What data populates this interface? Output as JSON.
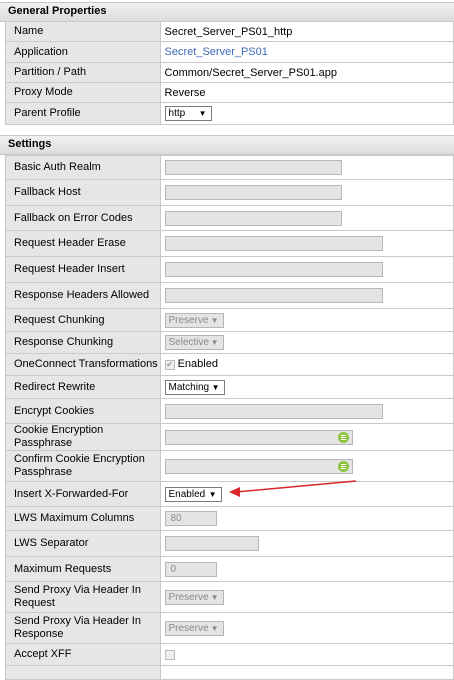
{
  "general": {
    "title": "General Properties",
    "rows": [
      {
        "label": "Name",
        "value": "Secret_Server_PS01_http"
      },
      {
        "label": "Application",
        "value": "Secret_Server_PS01"
      },
      {
        "label": "Partition / Path",
        "value": "Common/Secret_Server_PS01.app"
      },
      {
        "label": "Proxy Mode",
        "value": "Reverse"
      },
      {
        "label": "Parent Profile",
        "value": "http"
      }
    ]
  },
  "settings": {
    "title": "Settings",
    "rows": [
      {
        "label": "Basic Auth Realm"
      },
      {
        "label": "Fallback Host"
      },
      {
        "label": "Fallback on Error Codes"
      },
      {
        "label": "Request Header Erase"
      },
      {
        "label": "Request Header Insert"
      },
      {
        "label": "Response Headers Allowed"
      },
      {
        "label": "Request Chunking",
        "value": "Preserve"
      },
      {
        "label": "Response Chunking",
        "value": "Selective"
      },
      {
        "label": "OneConnect Transformations",
        "value": "Enabled"
      },
      {
        "label": "Redirect Rewrite",
        "value": "Matching"
      },
      {
        "label": "Encrypt Cookies"
      },
      {
        "label": "Cookie Encryption Passphrase"
      },
      {
        "label": "Confirm Cookie Encryption Passphrase"
      },
      {
        "label": "Insert X-Forwarded-For",
        "value": "Enabled"
      },
      {
        "label": "LWS Maximum Columns",
        "value": "80"
      },
      {
        "label": "LWS Separator"
      },
      {
        "label": "Maximum Requests",
        "value": "0"
      },
      {
        "label": "Send Proxy Via Header In Request",
        "value": "Preserve"
      },
      {
        "label": "Send Proxy Via Header In Response",
        "value": "Preserve"
      },
      {
        "label": "Accept XFF"
      }
    ]
  },
  "icons": {
    "dropdown": "chevron-down-icon",
    "passphrase": "password-generator-icon",
    "annotation": "red-arrow"
  },
  "colors": {
    "link": "#3c68b6",
    "annotation_arrow": "#d9262a",
    "icon_green": "#8cc63e"
  }
}
